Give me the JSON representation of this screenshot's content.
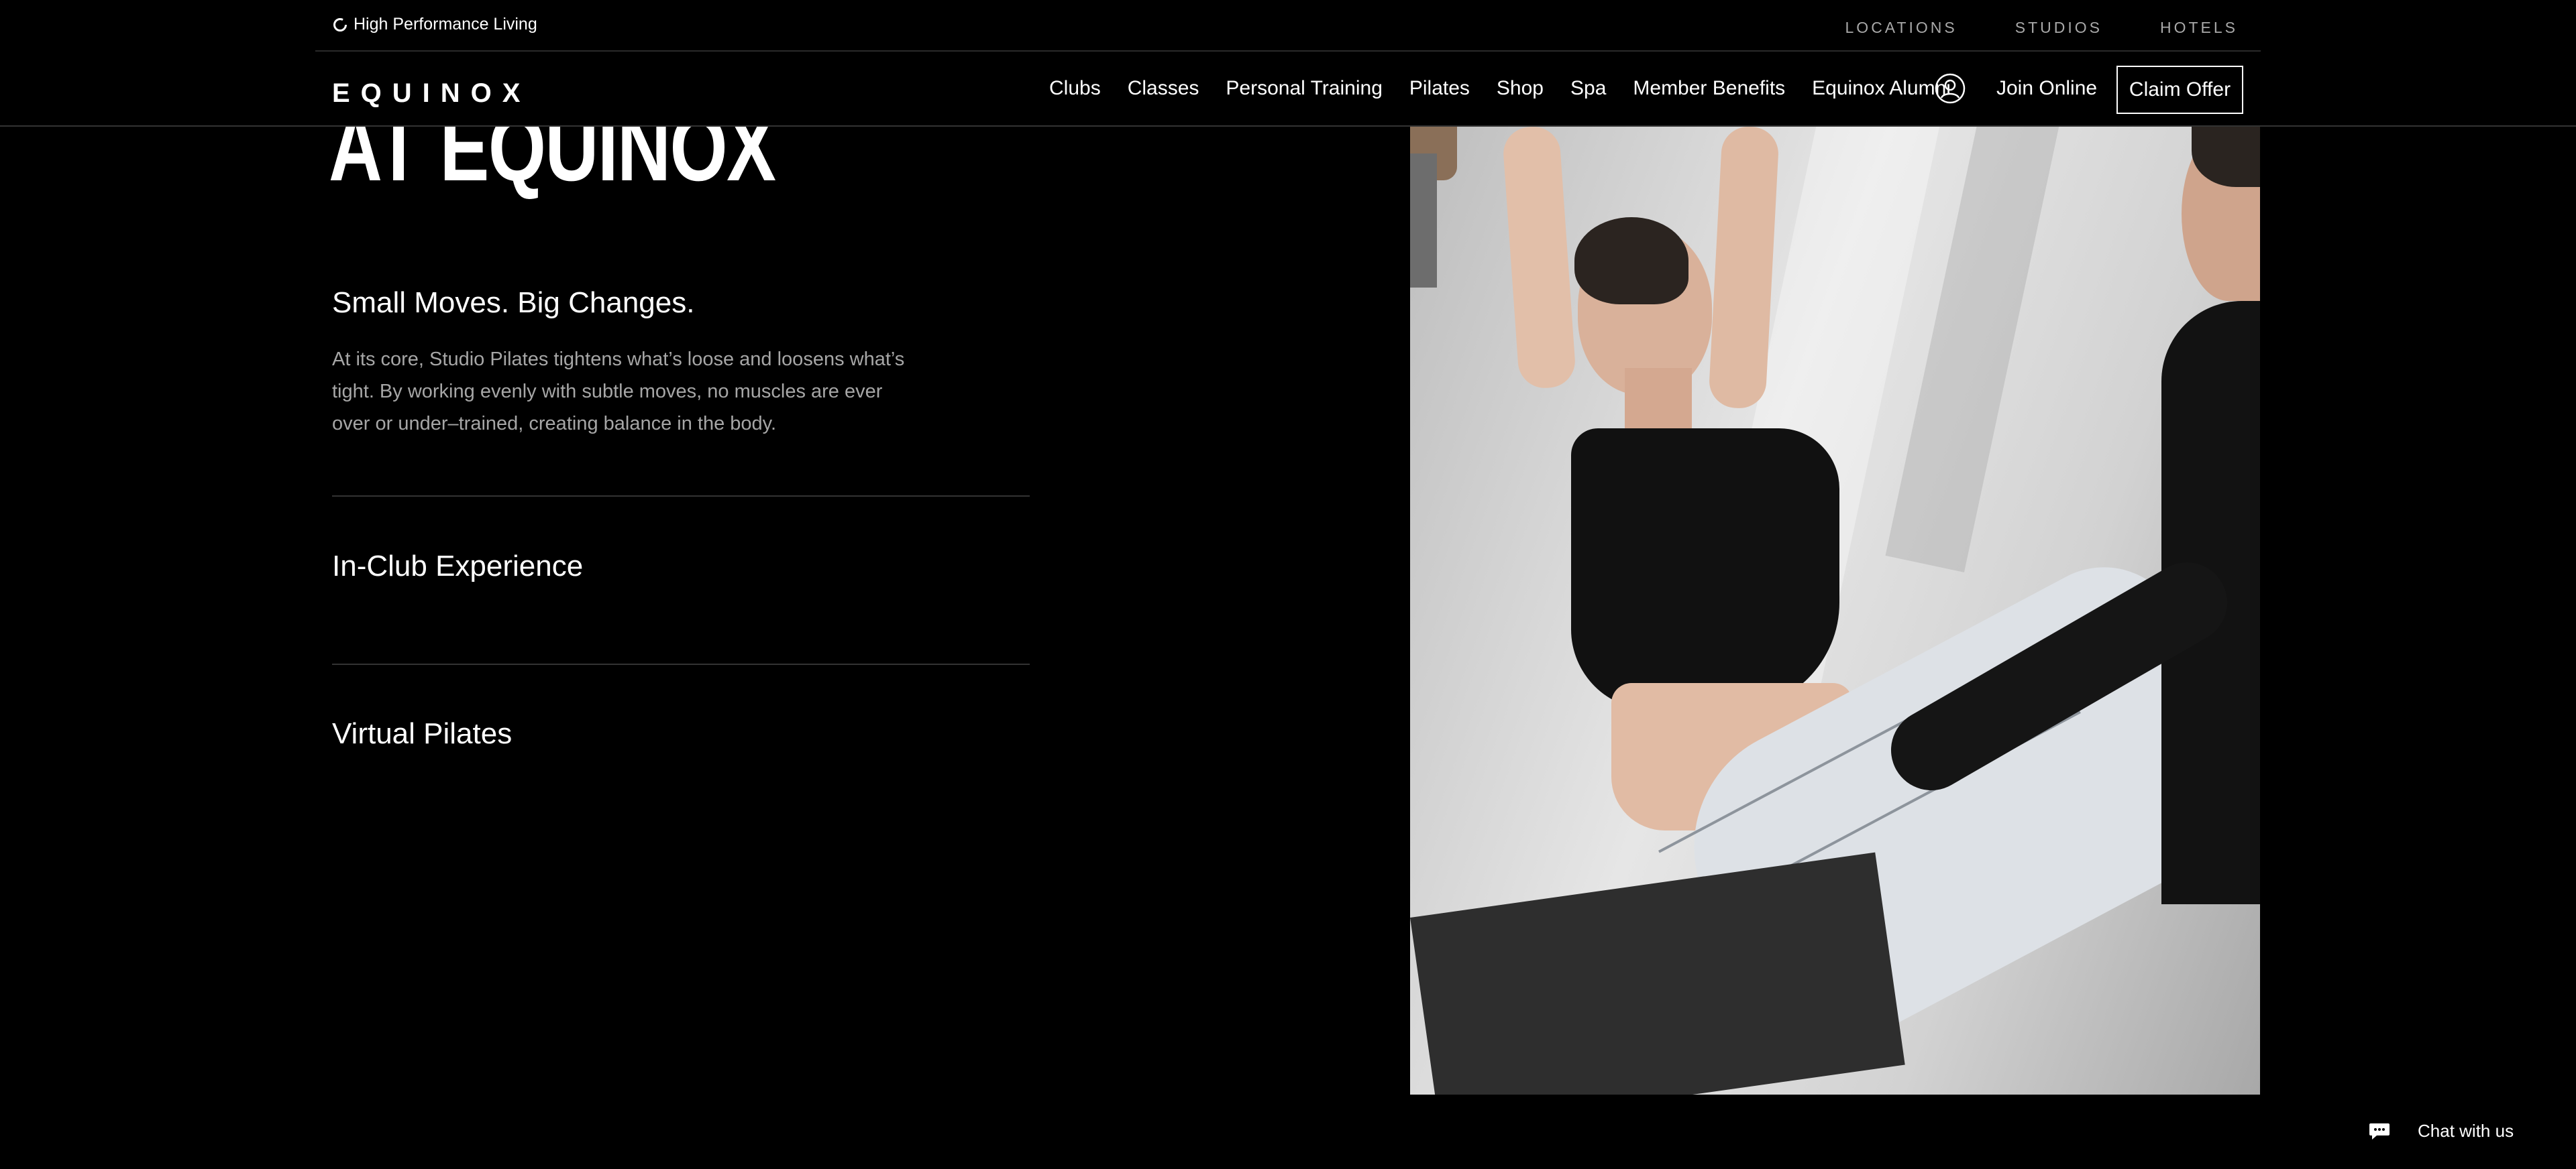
{
  "utility_bar": {
    "tagline": "High Performance Living",
    "links": [
      "LOCATIONS",
      "STUDIOS",
      "HOTELS"
    ]
  },
  "nav": {
    "logo": "EQUINOX",
    "links": [
      "Clubs",
      "Classes",
      "Personal Training",
      "Pilates",
      "Shop",
      "Spa",
      "Member Benefits",
      "Equinox Alumni"
    ],
    "account_icon": "user-circle-icon",
    "join_online": "Join Online",
    "claim_offer": "Claim Offer"
  },
  "main": {
    "heading": "AT EQUINOX",
    "intro": {
      "title": "Small Moves. Big Changes.",
      "body": "At its core, Studio Pilates tightens what’s loose and loosens what’s tight. By working evenly with subtle moves, no muscles are ever over or under–trained, creating balance in the body."
    },
    "accordion": [
      {
        "title": "In-Club Experience"
      },
      {
        "title": "Virtual Pilates"
      }
    ]
  },
  "chat": {
    "icon": "chat-bubble-icon",
    "label": "Chat with us"
  },
  "colors": {
    "background": "#000000",
    "text": "#ffffff",
    "muted_text": "#a6a6a6",
    "divider": "#333333"
  }
}
